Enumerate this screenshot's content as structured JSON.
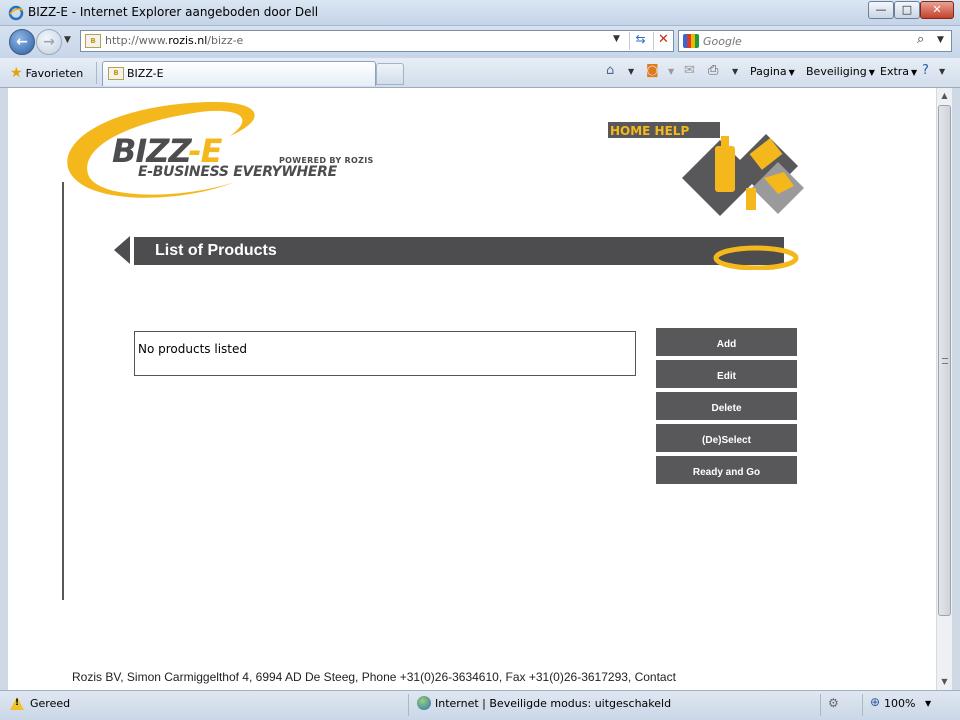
{
  "window": {
    "title": "BIZZ-E - Internet Explorer aangeboden door Dell",
    "minimize": "—",
    "maximize": "□",
    "close": "✕"
  },
  "navbar": {
    "url_prefix": "http://www.",
    "url_domain": "rozis.nl",
    "url_path": "/bizz-e",
    "search_placeholder": "Google"
  },
  "favbar": {
    "favorites_label": "Favorieten",
    "tab_title": "BIZZ-E",
    "commands": {
      "page": "Pagina",
      "security": "Beveiliging",
      "extra": "Extra"
    }
  },
  "page": {
    "logo": {
      "name_main": "BIZZ",
      "name_accent": "-E",
      "tagline": "E-BUSINESS EVERYWHERE",
      "powered_by": "POWERED BY ROZIS"
    },
    "home_help": "HOME HELP",
    "title": "List of Products",
    "product_list": {
      "empty_message": "No products listed"
    },
    "actions": {
      "add": "Add",
      "edit": "Edit",
      "delete": "Delete",
      "deselect": "(De)Select",
      "ready": "Ready and Go"
    },
    "footer": "Rozis BV, Simon Carmiggelthof 4, 6994 AD De Steeg, Phone +31(0)26-3634610, Fax +31(0)26-3617293, Contact"
  },
  "statusbar": {
    "status": "Gereed",
    "zone": "Internet | Beveiligde modus: uitgeschakeld",
    "zoom": "100%"
  },
  "colors": {
    "brand_yellow": "#f4b81c",
    "brand_gray": "#58585a",
    "band_gray": "#4d4d4f"
  }
}
